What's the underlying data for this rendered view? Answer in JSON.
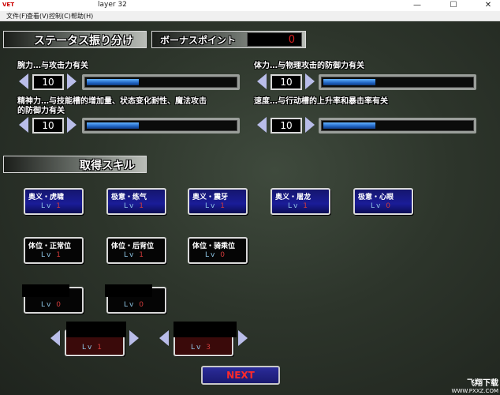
{
  "window": {
    "icon_text": "VET",
    "title": "layer 32",
    "menu": [
      "文件(F)",
      "查看(V)",
      "控制(C)",
      "帮助(H)"
    ]
  },
  "header": {
    "status_title": "ステータス振り分け",
    "bonus_label": "ボーナスポイント",
    "bonus_points": "0"
  },
  "stats": [
    {
      "label": "腕力…与攻击力有关",
      "value": "10",
      "level": 0.35
    },
    {
      "label": "体力…与物理攻击的防御力有关",
      "value": "10",
      "level": 0.35
    },
    {
      "label": "精神力…与技能槽的增加量、状态变化耐性、魔法攻击的防御力有关",
      "label_line1": "精神力…与技能槽的增加量、状态变化耐性、魔法攻击",
      "label_line2": "的防御力有关",
      "value": "10",
      "level": 0.35
    },
    {
      "label": "速度…与行动槽的上升率和暴击率有关",
      "value": "10",
      "level": 0.35
    }
  ],
  "skills_title": "取得スキル",
  "skills": [
    {
      "name": "奥义・虎啸",
      "lv_label": "Lv",
      "lv": "1"
    },
    {
      "name": "极意・练气",
      "lv_label": "Lv",
      "lv": "1"
    },
    {
      "name": "奥义・震牙",
      "lv_label": "Lv",
      "lv": "1"
    },
    {
      "name": "奥义・屠龙",
      "lv_label": "Lv",
      "lv": "1"
    },
    {
      "name": "极意・心眼",
      "lv_label": "Lv",
      "lv": "0"
    },
    {
      "name": "体位・正常位",
      "lv_label": "Lv",
      "lv": "1"
    },
    {
      "name": "体位・后背位",
      "lv_label": "Lv",
      "lv": "1"
    },
    {
      "name": "体位・骑乘位",
      "lv_label": "Lv",
      "lv": "0"
    },
    {
      "name": "",
      "lv_label": "Lv",
      "lv": "0"
    },
    {
      "name": "",
      "lv_label": "Lv",
      "lv": "0"
    },
    {
      "name": "",
      "lv_label": "Lv",
      "lv": "1"
    },
    {
      "name": "",
      "lv_label": "Lv",
      "lv": "3"
    }
  ],
  "next_label": "NEXT",
  "watermark": {
    "line1": "飞翔下载",
    "line2": "WWW.PXXZ.COM"
  },
  "colors": {
    "accent_blue": "#1a1c98",
    "bar_fill": "#3a8ae0",
    "value_red": "#d23b3b"
  }
}
